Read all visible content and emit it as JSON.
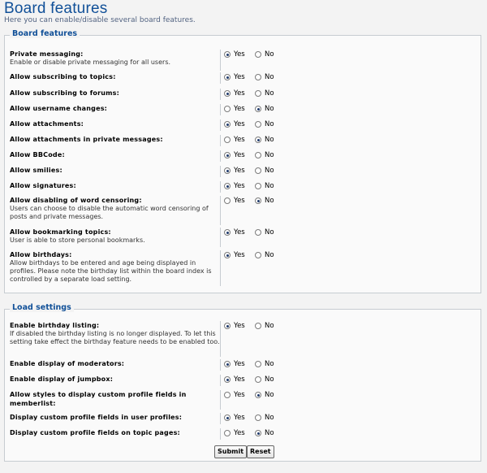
{
  "page": {
    "title": "Board features",
    "description": "Here you can enable/disable several board features."
  },
  "board_features": {
    "legend": "Board features",
    "rows": [
      {
        "title": "Private messaging:",
        "desc": "Enable or disable private messaging for all users.",
        "value": "yes"
      },
      {
        "title": "Allow subscribing to topics:",
        "desc": "",
        "value": "yes"
      },
      {
        "title": "Allow subscribing to forums:",
        "desc": "",
        "value": "yes"
      },
      {
        "title": "Allow username changes:",
        "desc": "",
        "value": "no"
      },
      {
        "title": "Allow attachments:",
        "desc": "",
        "value": "yes"
      },
      {
        "title": "Allow attachments in private messages:",
        "desc": "",
        "value": "no"
      },
      {
        "title": "Allow BBCode:",
        "desc": "",
        "value": "yes"
      },
      {
        "title": "Allow smilies:",
        "desc": "",
        "value": "yes"
      },
      {
        "title": "Allow signatures:",
        "desc": "",
        "value": "yes"
      },
      {
        "title": "Allow disabling of word censoring:",
        "desc": "Users can choose to disable the automatic word censoring of posts and private messages.",
        "value": "no"
      },
      {
        "title": "Allow bookmarking topics:",
        "desc": "User is able to store personal bookmarks.",
        "value": "yes"
      },
      {
        "title": "Allow birthdays:",
        "desc": "Allow birthdays to be entered and age being displayed in profiles. Please note the birthday list within the board index is controlled by a separate load setting.",
        "value": "yes"
      }
    ]
  },
  "load_settings": {
    "legend": "Load settings",
    "rows": [
      {
        "title": "Enable birthday listing:",
        "desc": "If disabled the birthday listing is no longer displayed. To let this setting take effect the birthday feature needs to be enabled too.",
        "value": "yes"
      },
      {
        "title": "Enable display of moderators:",
        "desc": "",
        "value": "yes"
      },
      {
        "title": "Enable display of jumpbox:",
        "desc": "",
        "value": "yes"
      },
      {
        "title": "Allow styles to display custom profile fields in memberlist:",
        "desc": "",
        "value": "no"
      },
      {
        "title": "Display custom profile fields in user profiles:",
        "desc": "",
        "value": "yes"
      },
      {
        "title": "Display custom profile fields on topic pages:",
        "desc": "",
        "value": "no"
      }
    ]
  },
  "labels": {
    "yes": "Yes",
    "no": "No"
  },
  "buttons": {
    "submit": "Submit",
    "reset": "Reset"
  }
}
